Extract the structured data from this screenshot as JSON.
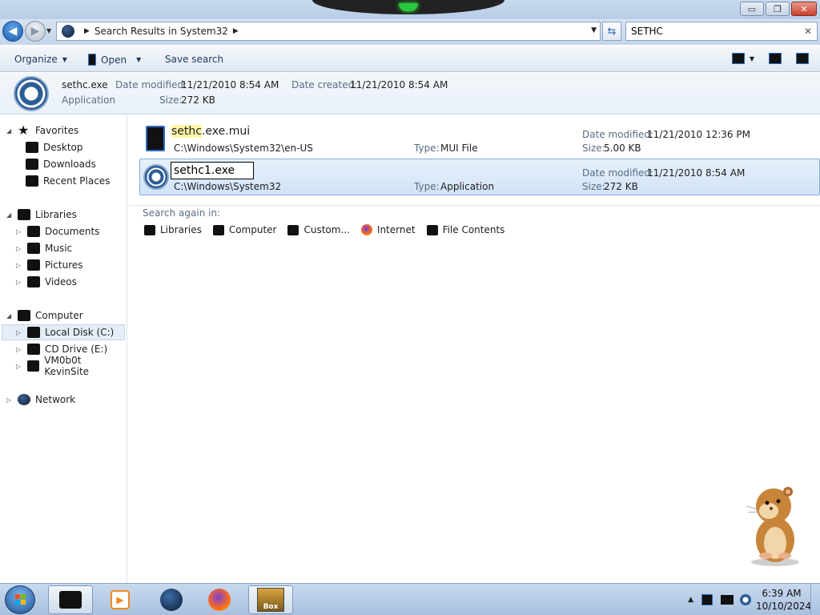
{
  "window": {
    "minimize": "▭",
    "maximize": "❐",
    "close": "✕"
  },
  "nav": {
    "breadcrumb": "Search Results in System32",
    "search_value": "SETHC",
    "search_clear": "✕"
  },
  "toolbar": {
    "organize": "Organize",
    "open": "Open",
    "save_search": "Save search"
  },
  "details": {
    "name": "sethc.exe",
    "kind": "Application",
    "modified_label": "Date modified:",
    "modified_value": "11/21/2010 8:54 AM",
    "created_label": "Date created:",
    "created_value": "11/21/2010 8:54 AM",
    "size_label": "Size:",
    "size_value": "272 KB"
  },
  "sidebar": {
    "favorites": "Favorites",
    "desktop": "Desktop",
    "downloads": "Downloads",
    "recent": "Recent Places",
    "libraries": "Libraries",
    "documents": "Documents",
    "music": "Music",
    "pictures": "Pictures",
    "videos": "Videos",
    "computer": "Computer",
    "local_disk": "Local Disk (C:)",
    "cd_drive": "CD Drive (E:)",
    "vm_share": "VM0b0t KevinSite",
    "network": "Network"
  },
  "results": [
    {
      "name_highlight": "sethc",
      "name_rest": ".exe.mui",
      "path": "C:\\Windows\\System32\\en-US",
      "type_label": "Type:",
      "type_value": "MUI File",
      "modified_label": "Date modified:",
      "modified_value": "11/21/2010 12:36 PM",
      "size_label": "Size:",
      "size_value": "5.00 KB"
    },
    {
      "rename_value": "sethc1.exe",
      "path": "C:\\Windows\\System32",
      "type_label": "Type:",
      "type_value": "Application",
      "modified_label": "Date modified:",
      "modified_value": "11/21/2010 8:54 AM",
      "size_label": "Size:",
      "size_value": "272 KB"
    }
  ],
  "search_again": {
    "label": "Search again in:",
    "libraries": "Libraries",
    "computer": "Computer",
    "custom": "Custom...",
    "internet": "Internet",
    "file_contents": "File Contents"
  },
  "taskbar": {
    "time": "6:39 AM",
    "date": "10/10/2024",
    "box_label": "Box"
  }
}
